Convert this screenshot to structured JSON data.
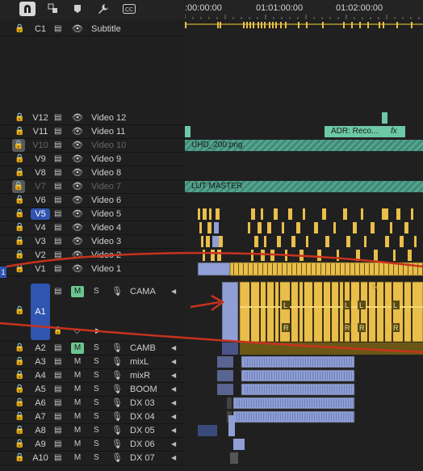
{
  "toolbar": {
    "icons": [
      "snap-icon",
      "linked-selection-icon",
      "marker-icon",
      "wrench-icon",
      "captions-icon"
    ]
  },
  "ruler": {
    "timecodes": [
      ":00:00:00",
      "01:01:00:00",
      "01:02:00:00"
    ]
  },
  "subtitle_track": {
    "lock": "🔒",
    "name": "C1",
    "label": "Subtitle"
  },
  "video_tracks": [
    {
      "name": "V12",
      "label": "Video 12",
      "locked": false,
      "dim": false,
      "selected": false
    },
    {
      "name": "V11",
      "label": "Video 11",
      "locked": false,
      "dim": false,
      "selected": false
    },
    {
      "name": "V10",
      "label": "Video 10",
      "locked": true,
      "dim": true,
      "selected": false
    },
    {
      "name": "V9",
      "label": "Video 9",
      "locked": false,
      "dim": false,
      "selected": false
    },
    {
      "name": "V8",
      "label": "Video 8",
      "locked": false,
      "dim": false,
      "selected": false
    },
    {
      "name": "V7",
      "label": "Video 7",
      "locked": true,
      "dim": true,
      "selected": false
    },
    {
      "name": "V6",
      "label": "Video 6",
      "locked": false,
      "dim": false,
      "selected": false
    },
    {
      "name": "V5",
      "label": "Video 5",
      "locked": false,
      "dim": false,
      "selected": true
    },
    {
      "name": "V4",
      "label": "Video 4",
      "locked": false,
      "dim": false,
      "selected": false
    },
    {
      "name": "V3",
      "label": "Video 3",
      "locked": false,
      "dim": false,
      "selected": false
    },
    {
      "name": "V2",
      "label": "Video 2",
      "locked": false,
      "dim": false,
      "selected": false
    },
    {
      "name": "V1",
      "label": "Video 1",
      "locked": false,
      "dim": false,
      "selected": false
    }
  ],
  "audio_tracks": [
    {
      "name": "A1",
      "label": "CAMA",
      "mute": "M",
      "solo": "S",
      "mute_on": true,
      "selected": true
    },
    {
      "name": "A2",
      "label": "CAMB",
      "mute": "M",
      "solo": "S",
      "mute_on": true,
      "selected": false
    },
    {
      "name": "A3",
      "label": "mixL",
      "mute": "M",
      "solo": "S",
      "mute_on": false,
      "selected": false
    },
    {
      "name": "A4",
      "label": "mixR",
      "mute": "M",
      "solo": "S",
      "mute_on": false,
      "selected": false
    },
    {
      "name": "A5",
      "label": "BOOM",
      "mute": "M",
      "solo": "S",
      "mute_on": false,
      "selected": false
    },
    {
      "name": "A6",
      "label": "DX 03",
      "mute": "M",
      "solo": "S",
      "mute_on": false,
      "selected": false
    },
    {
      "name": "A7",
      "label": "DX 04",
      "mute": "M",
      "solo": "S",
      "mute_on": false,
      "selected": false
    },
    {
      "name": "A8",
      "label": "DX 05",
      "mute": "M",
      "solo": "S",
      "mute_on": false,
      "selected": false
    },
    {
      "name": "A9",
      "label": "DX 06",
      "mute": "M",
      "solo": "S",
      "mute_on": false,
      "selected": false
    },
    {
      "name": "A10",
      "label": "DX 07",
      "mute": "M",
      "solo": "S",
      "mute_on": false,
      "selected": false
    }
  ],
  "clips": {
    "v10_clip": "UHD_200.png",
    "v7_clip": "LUT MASTER",
    "v11_clip": "ADR: Reco...",
    "fx_badge": "fx",
    "channel_left": "L",
    "channel_right": "R"
  },
  "partial_track_marker": "1",
  "colors": {
    "video_clip": "#e9be4a",
    "audio_clip": "#8f9fd6",
    "graphic_clip": "#55a48e",
    "selected_track": "#2f55b0",
    "mute_on": "#6cc58f",
    "annotation": "#c8321e"
  }
}
